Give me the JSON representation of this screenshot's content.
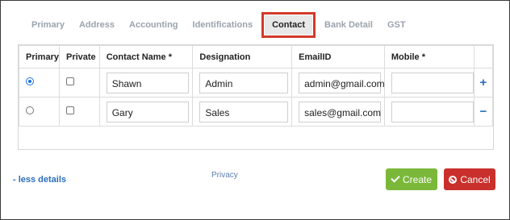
{
  "tabs": [
    {
      "label": "Primary"
    },
    {
      "label": "Address"
    },
    {
      "label": "Accounting"
    },
    {
      "label": "Identifications"
    },
    {
      "label": "Contact"
    },
    {
      "label": "Bank Detail"
    },
    {
      "label": "GST"
    }
  ],
  "table": {
    "headers": {
      "primary": "Primary",
      "private": "Private",
      "contact_name": "Contact Name *",
      "designation": "Designation",
      "email": "EmailID",
      "mobile": "Mobile *"
    },
    "rows": [
      {
        "primary_selected": true,
        "private_checked": false,
        "contact_name": "Shawn",
        "designation": "Admin",
        "email": "admin@gmail.com",
        "mobile": "",
        "action": "+"
      },
      {
        "primary_selected": false,
        "private_checked": false,
        "contact_name": "Gary",
        "designation": "Sales",
        "email": "sales@gmail.com",
        "mobile": "",
        "action": "−"
      }
    ]
  },
  "footer": {
    "less_details": "- less details",
    "privacy": "Privacy",
    "create": "Create",
    "cancel": "Cancel"
  },
  "colors": {
    "active_tab_outline": "#d23a2a",
    "create_button": "#7bb83a",
    "cancel_button": "#c9302c",
    "link": "#2a6ebb"
  }
}
